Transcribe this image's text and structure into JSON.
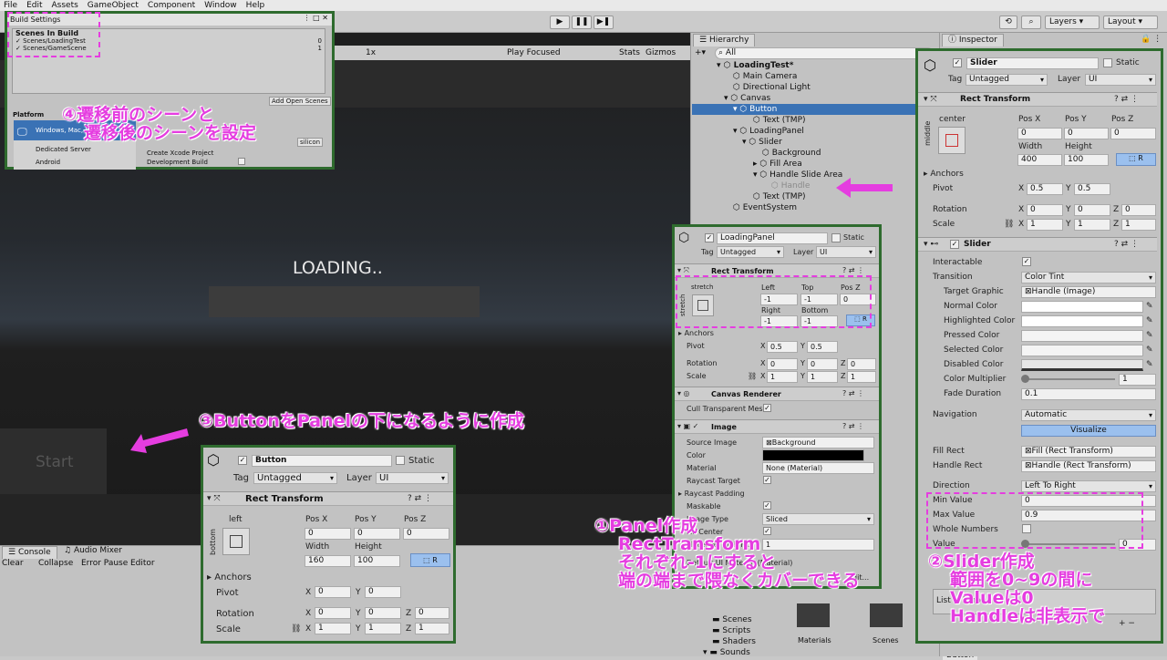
{
  "menu": [
    "File",
    "Edit",
    "Assets",
    "GameObject",
    "Component",
    "Window",
    "Help"
  ],
  "toolbar": {
    "layers": "Layers",
    "layout": "Layout"
  },
  "gamebar": {
    "zoom": "1x",
    "play_focused": "Play Focused",
    "stats": "Stats",
    "gizmos": "Gizmos"
  },
  "game": {
    "loading": "LOADING..",
    "start": "Start"
  },
  "build": {
    "title": "Build Settings",
    "scenes_header": "Scenes In Build",
    "scenes": [
      {
        "name": "Scenes/LoadingTest",
        "index": "0"
      },
      {
        "name": "Scenes/GameScene",
        "index": "1"
      }
    ],
    "add_open": "Add Open Scenes",
    "platform_header": "Platform",
    "platforms": [
      "Windows, Mac, Linux",
      "Dedicated Server",
      "Android"
    ],
    "silicon": "silicon",
    "xcode": "Create Xcode Project",
    "devbuild": "Development Build"
  },
  "hierarchy": {
    "tab": "Hierarchy",
    "search": "All",
    "items": [
      "LoadingTest*",
      "Main Camera",
      "Directional Light",
      "Canvas",
      "Button",
      "Text (TMP)",
      "LoadingPanel",
      "Slider",
      "Background",
      "Fill Area",
      "Handle Slide Area",
      "Handle",
      "Text (TMP)",
      "EventSystem"
    ]
  },
  "inspector": {
    "tab": "Inspector",
    "name": "Slider",
    "static": "Static",
    "tag_label": "Tag",
    "tag": "Untagged",
    "layer_label": "Layer",
    "layer": "UI",
    "rect": {
      "title": "Rect Transform",
      "anchor": "center",
      "side": "middle",
      "posx_l": "Pos X",
      "posy_l": "Pos Y",
      "posz_l": "Pos Z",
      "posx": "0",
      "posy": "0",
      "posz": "0",
      "width_l": "Width",
      "height_l": "Height",
      "width": "400",
      "height": "100",
      "anchors": "Anchors",
      "pivot": "Pivot",
      "pivot_x": "0.5",
      "pivot_y": "0.5",
      "rotation": "Rotation",
      "rx": "0",
      "ry": "0",
      "rz": "0",
      "scale": "Scale",
      "sx": "1",
      "sy": "1",
      "sz": "1"
    },
    "slider": {
      "title": "Slider",
      "interactable": "Interactable",
      "transition": "Transition",
      "transition_v": "Color Tint",
      "target_graphic": "Target Graphic",
      "target_graphic_v": "Handle (Image)",
      "normal": "Normal Color",
      "highlighted": "Highlighted Color",
      "pressed": "Pressed Color",
      "selected": "Selected Color",
      "disabled": "Disabled Color",
      "multiplier": "Color Multiplier",
      "multiplier_v": "1",
      "fade": "Fade Duration",
      "fade_v": "0.1",
      "navigation": "Navigation",
      "navigation_v": "Automatic",
      "visualize": "Visualize",
      "fill_rect": "Fill Rect",
      "fill_rect_v": "Fill (Rect Transform)",
      "handle_rect": "Handle Rect",
      "handle_rect_v": "Handle (Rect Transform)",
      "direction": "Direction",
      "direction_v": "Left To Right",
      "min": "Min Value",
      "min_v": "0",
      "max": "Max Value",
      "max_v": "0.9",
      "whole": "Whole Numbers",
      "value": "Value",
      "value_v": "0",
      "list_empty": "List is Empty"
    }
  },
  "panel": {
    "name": "LoadingPanel",
    "static": "Static",
    "tag_label": "Tag",
    "tag": "Untagged",
    "layer_label": "Layer",
    "layer": "UI",
    "rect": "Rect Transform",
    "stretch": "stretch",
    "left_l": "Left",
    "top_l": "Top",
    "posz_l": "Pos Z",
    "left": "-1",
    "top": "-1",
    "posz": "0",
    "right_l": "Right",
    "bottom_l": "Bottom",
    "right": "-1",
    "bottom": "-1",
    "anchors": "Anchors",
    "pivot": "Pivot",
    "px": "0.5",
    "py": "0.5",
    "rotation": "Rotation",
    "rx": "0",
    "ry": "0",
    "rz": "0",
    "scale": "Scale",
    "sx": "1",
    "sy": "1",
    "sz": "1",
    "canvas_renderer": "Canvas Renderer",
    "cull": "Cull Transparent Mes",
    "image": "Image",
    "source": "Source Image",
    "source_v": "Background",
    "color": "Color",
    "material": "Material",
    "material_v": "None (Material)",
    "raycast": "Raycast Target",
    "padding": "Raycast Padding",
    "maskable": "Maskable",
    "image_type": "Image Type",
    "image_type_v": "Sliced",
    "fill_center": "Fill Center",
    "ppu": "Pixels Per Unit Mul",
    "ppu_v": "1",
    "default_mat": "Default UI Material (Material)",
    "edit": "Edit..."
  },
  "button_panel": {
    "name": "Button",
    "static": "Static",
    "tag_label": "Tag",
    "tag": "Untagged",
    "layer_label": "Layer",
    "layer": "UI",
    "rect": "Rect Transform",
    "anchor": "left",
    "side": "bottom",
    "posx_l": "Pos X",
    "posy_l": "Pos Y",
    "posz_l": "Pos Z",
    "posx": "0",
    "posy": "0",
    "posz": "0",
    "width_l": "Width",
    "height_l": "Height",
    "width": "160",
    "height": "100",
    "anchors": "Anchors",
    "pivot": "Pivot",
    "px": "0",
    "py": "0",
    "rotation": "Rotation",
    "rx": "0",
    "ry": "0",
    "rz": "0",
    "scale": "Scale",
    "sx": "1",
    "sy": "1",
    "sz": "1"
  },
  "console": {
    "tab1": "Console",
    "tab2": "Audio Mixer",
    "clear": "Clear",
    "collapse": "Collapse",
    "error_pause": "Error Pause",
    "editor": "Editor"
  },
  "project": {
    "folders": [
      "Scenes",
      "Scripts",
      "Shaders",
      "Sounds"
    ],
    "assets": [
      "Materials",
      "Scenes"
    ],
    "bottom_tab": "Button"
  },
  "annotations": {
    "a1": [
      "①Panel作成",
      "RectTransform",
      "それぞれ-1にすると",
      "端の端まで隈なくカバーできる"
    ],
    "a2": [
      "②Slider作成",
      "範囲を0~9の間に",
      "Valueは0",
      "Handleは非表示で"
    ],
    "a3": "③ButtonをPanelの下になるように作成",
    "a4": [
      "④遷移前のシーンと",
      "遷移後のシーンを設定"
    ]
  },
  "colors": {
    "annotation": "#e53de0",
    "panel_border": "#2e6b2e",
    "selection": "#3a72b5"
  }
}
